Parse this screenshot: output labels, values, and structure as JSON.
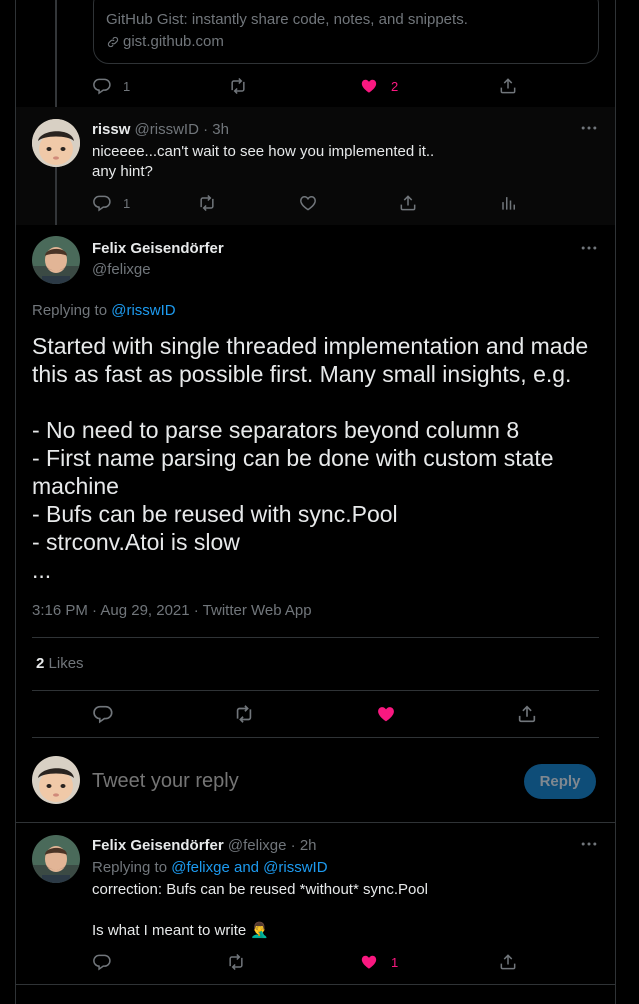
{
  "card": {
    "title": "GitHub Gist: instantly share code, notes, and snippets.",
    "domain": "gist.github.com"
  },
  "tweet1_actions": {
    "replies": "1",
    "likes": "2"
  },
  "reply1": {
    "name": "rissw",
    "handle": "@risswID",
    "time": "3h",
    "text_line1": "niceeee...can't wait to see how you implemented it..",
    "text_line2": "any hint?",
    "replies": "1"
  },
  "main": {
    "name": "Felix Geisendörfer",
    "handle": "@felixge",
    "replying_prefix": "Replying to",
    "replying_to": "@risswID",
    "text_lines": [
      "Started with single threaded implementation and made",
      "this as fast as possible first. Many small insights, e.g.",
      "- No need to parse separators beyond column 8",
      "- First name parsing can be done with custom state",
      "machine",
      "- Bufs can be reused with sync.Pool",
      "- strconv.Atoi is slow",
      "..."
    ],
    "timestamp": "3:16 PM · Aug 29, 2021 · Twitter Web App",
    "likes_count": "2",
    "likes_label": "Likes"
  },
  "compose": {
    "placeholder": "Tweet your reply",
    "reply_button": "Reply"
  },
  "reply2": {
    "name": "Felix Geisendörfer",
    "handle": "@felixge",
    "time": "2h",
    "replying_prefix": "Replying to",
    "replying_to": "@felixge and @risswID",
    "text_line1": "correction: Bufs can be reused *without* sync.Pool",
    "text_line2": "Is what I meant to write 🤦‍♂️",
    "likes": "1"
  },
  "colors": {
    "background": "#000000",
    "text": "#e7e9ea",
    "muted": "#71767b",
    "accent": "#1d9bf0",
    "like": "#f91880"
  },
  "icons": [
    "reply-icon",
    "retweet-icon",
    "like-icon",
    "share-icon",
    "analytics-icon",
    "more-icon",
    "link-icon"
  ]
}
